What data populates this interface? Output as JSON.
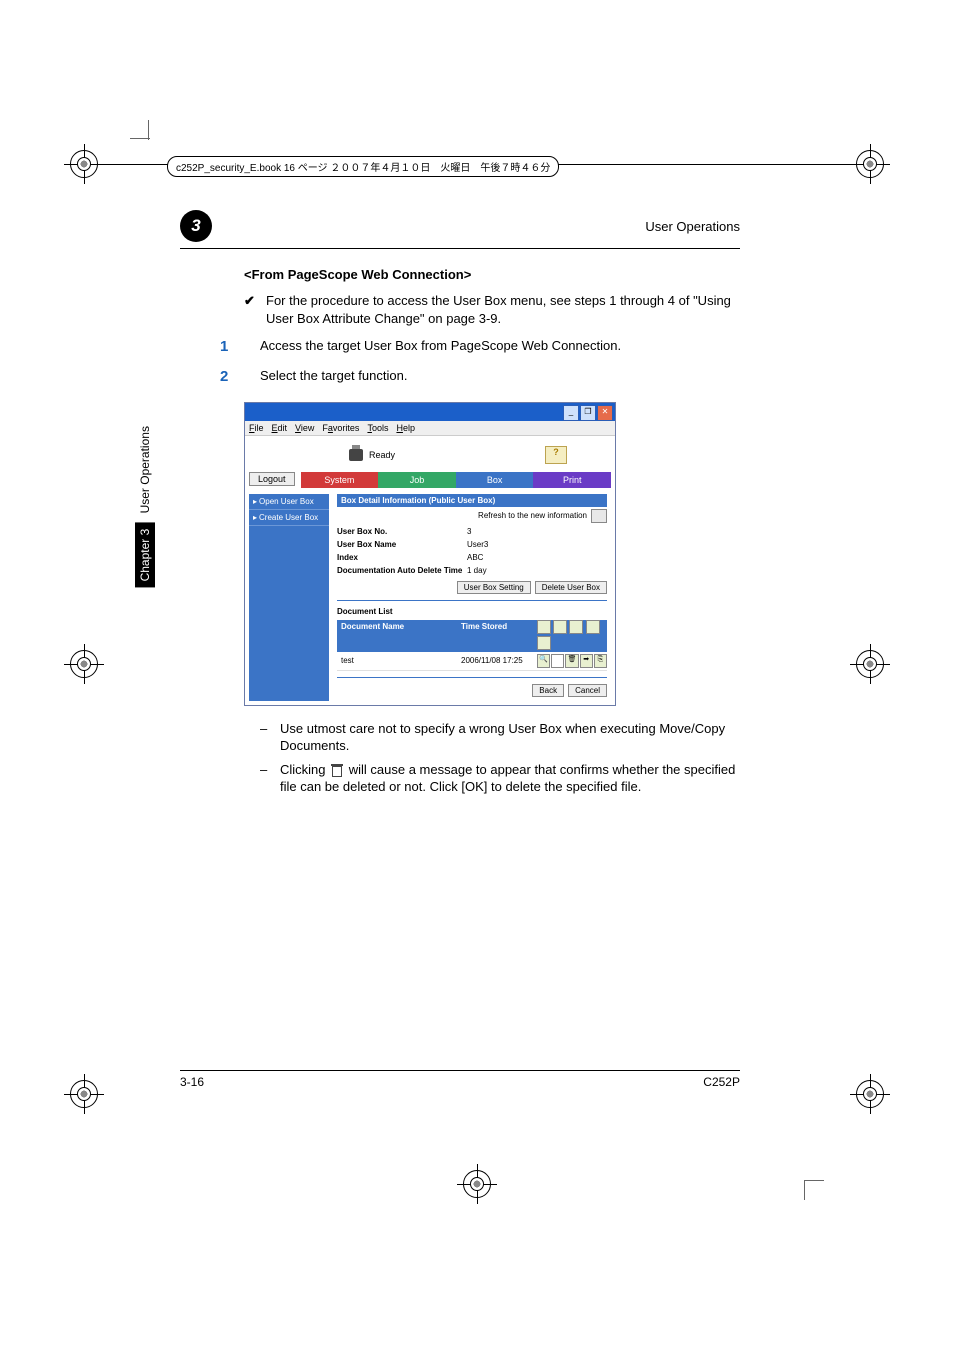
{
  "header_box": "c252P_security_E.book  16 ページ  ２００７年４月１０日　火曜日　午後７時４６分",
  "running_head": {
    "chapter_number": "3",
    "title": "User Operations"
  },
  "section_title": "<From PageScope Web Connection>",
  "intro_bullet_mark": "✔",
  "intro_bullet": "For the procedure to access the User Box menu, see steps 1 through 4 of \"Using User Box Attribute Change\" on page 3-9.",
  "steps": [
    {
      "num": "1",
      "text": "Access the target User Box from PageScope Web Connection."
    },
    {
      "num": "2",
      "text": "Select the target function."
    }
  ],
  "screenshot": {
    "win_buttons": [
      "_",
      "❐",
      "✕"
    ],
    "menus": [
      "File",
      "Edit",
      "View",
      "Favorites",
      "Tools",
      "Help"
    ],
    "status_label": "Ready",
    "logout": "Logout",
    "tabs": {
      "system": "System",
      "job": "Job",
      "box": "Box",
      "print": "Print"
    },
    "sidebar": [
      "Open User Box",
      "Create User Box"
    ],
    "main_heading": "Box Detail Information (Public User Box)",
    "refresh_label": "Refresh to the new information",
    "fields": {
      "user_box_no_k": "User Box No.",
      "user_box_no_v": "3",
      "user_box_name_k": "User Box Name",
      "user_box_name_v": "User3",
      "index_k": "Index",
      "index_v": "ABC",
      "auto_del_k": "Documentation Auto Delete Time",
      "auto_del_v": "1 day"
    },
    "buttons": {
      "setting": "User Box Setting",
      "delete": "Delete User Box",
      "back": "Back",
      "cancel": "Cancel"
    },
    "doc_list_title": "Document List",
    "doc_table": {
      "h1": "Document Name",
      "h2": "Time Stored",
      "row": {
        "name": "test",
        "time": "2006/11/08 17:25"
      }
    }
  },
  "notes": [
    "Use utmost care not to specify a wrong User Box when executing Move/Copy Documents.",
    "Clicking  will cause a message to appear that confirms whether the specified file can be deleted or not. Click [OK] to delete the specified file."
  ],
  "note2_parts": {
    "a": "Clicking ",
    "b": " will cause a message to appear that confirms whether the specified file can be deleted or not. Click [OK] to delete the specified file."
  },
  "side_tab": {
    "chapter": "Chapter 3",
    "title": "User Operations"
  },
  "footer": {
    "left": "3-16",
    "right": "C252P"
  }
}
